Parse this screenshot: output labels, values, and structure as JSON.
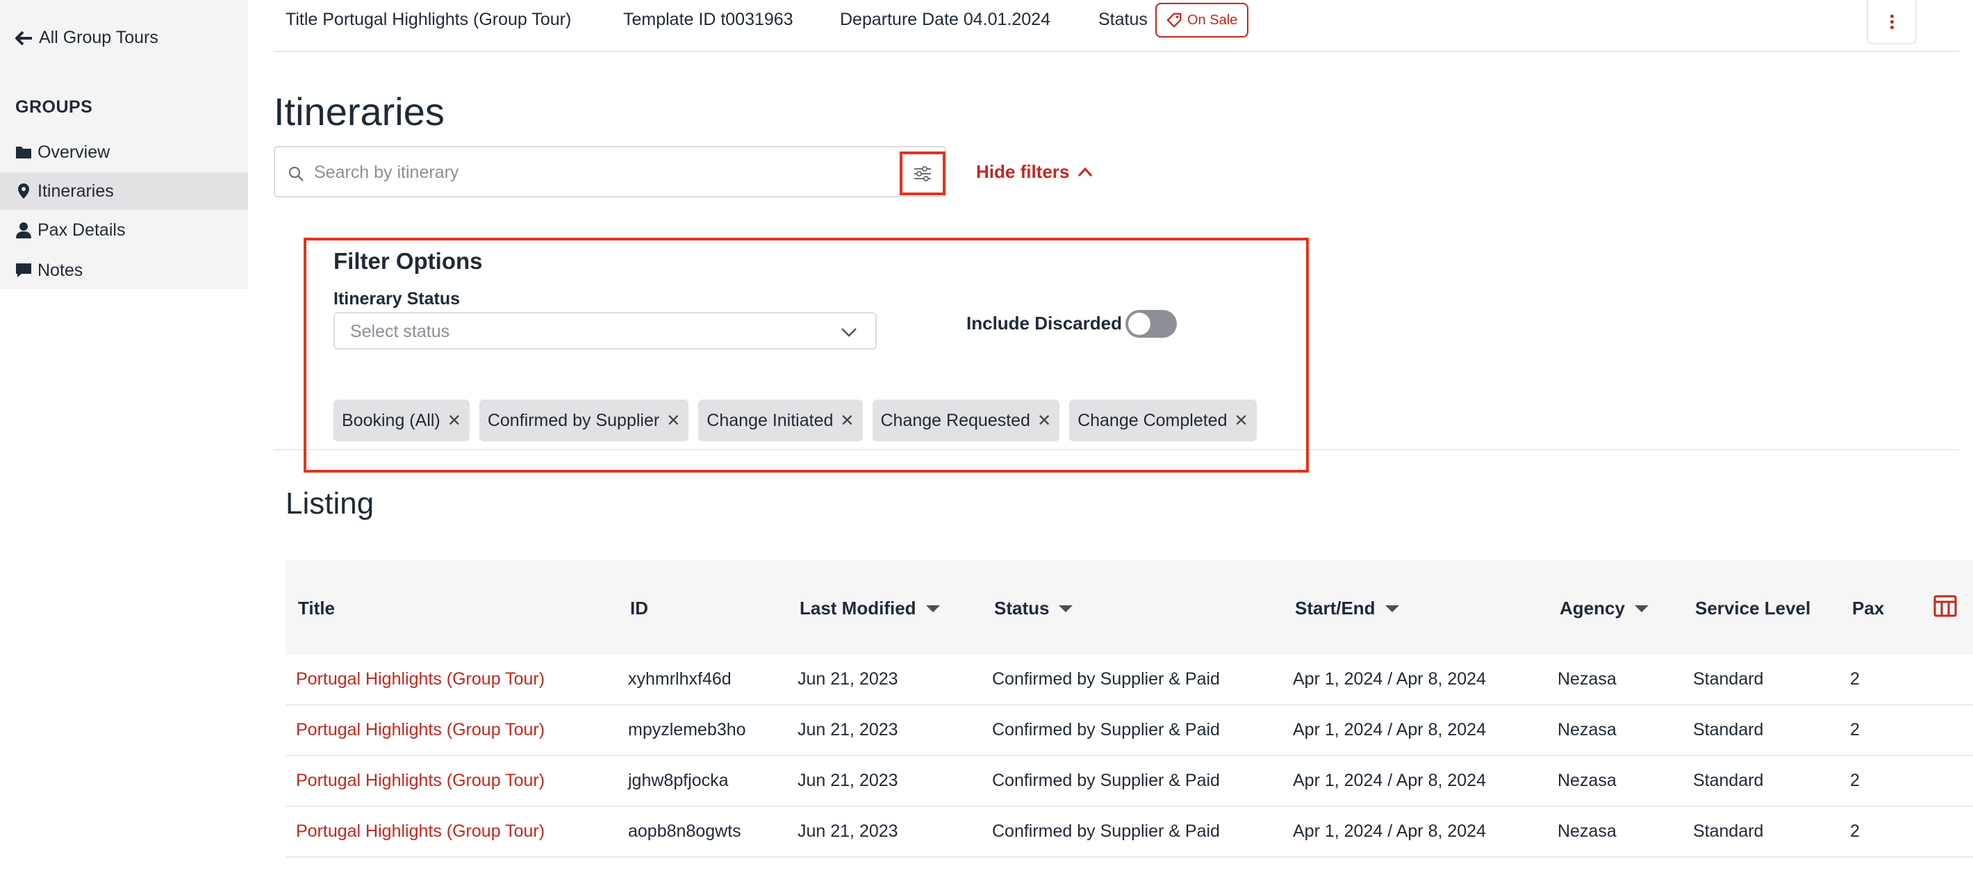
{
  "sidebar": {
    "back_label": "All Group Tours",
    "section_heading": "GROUPS",
    "items": [
      {
        "label": "Overview",
        "icon": "folder-icon"
      },
      {
        "label": "Itineraries",
        "icon": "map-pin-icon",
        "active": true
      },
      {
        "label": "Pax Details",
        "icon": "user-icon"
      },
      {
        "label": "Notes",
        "icon": "comment-icon"
      }
    ]
  },
  "header": {
    "title": "Title Portugal Highlights (Group Tour)",
    "template_id": "Template ID t0031963",
    "departure": "Departure Date 04.01.2024",
    "status_label": "Status",
    "status_badge": "On Sale"
  },
  "page": {
    "title": "Itineraries"
  },
  "search": {
    "placeholder": "Search by itinerary",
    "value": "",
    "hide_filters_label": "Hide filters"
  },
  "filters": {
    "title": "Filter Options",
    "status_label": "Itinerary Status",
    "status_placeholder": "Select status",
    "include_discarded_label": "Include Discarded",
    "include_discarded": false,
    "chips": [
      "Booking (All)",
      "Confirmed by Supplier",
      "Change Initiated",
      "Change Requested",
      "Change Completed"
    ]
  },
  "listing": {
    "title": "Listing",
    "columns": [
      "Title",
      "ID",
      "Last Modified",
      "Status",
      "Start/End",
      "Agency",
      "Service Level",
      "Pax"
    ],
    "rows": [
      {
        "title": "Portugal Highlights (Group Tour)",
        "id": "xyhmrlhxf46d",
        "modified": "Jun 21, 2023",
        "status": "Confirmed by Supplier & Paid",
        "start_end": "Apr 1, 2024 / Apr 8, 2024",
        "agency": "Nezasa",
        "service_level": "Standard",
        "pax": "2"
      },
      {
        "title": "Portugal Highlights (Group Tour)",
        "id": "mpyzlemeb3ho",
        "modified": "Jun 21, 2023",
        "status": "Confirmed by Supplier & Paid",
        "start_end": "Apr 1, 2024 / Apr 8, 2024",
        "agency": "Nezasa",
        "service_level": "Standard",
        "pax": "2"
      },
      {
        "title": "Portugal Highlights (Group Tour)",
        "id": "jghw8pfjocka",
        "modified": "Jun 21, 2023",
        "status": "Confirmed by Supplier & Paid",
        "start_end": "Apr 1, 2024 / Apr 8, 2024",
        "agency": "Nezasa",
        "service_level": "Standard",
        "pax": "2"
      },
      {
        "title": "Portugal Highlights (Group Tour)",
        "id": "aopb8n8ogwts",
        "modified": "Jun 21, 2023",
        "status": "Confirmed by Supplier & Paid",
        "start_end": "Apr 1, 2024 / Apr 8, 2024",
        "agency": "Nezasa",
        "service_level": "Standard",
        "pax": "2"
      }
    ]
  },
  "colors": {
    "accent": "#c0291e",
    "highlight": "#e0341e"
  }
}
